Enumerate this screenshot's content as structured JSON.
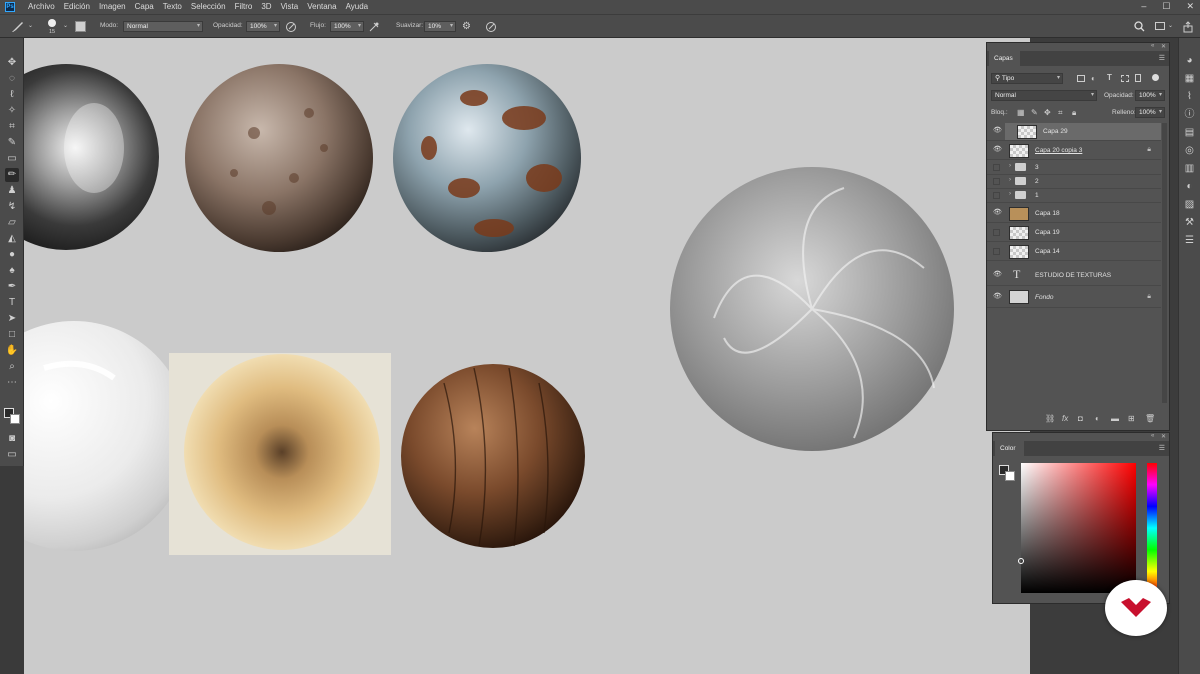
{
  "menubar": {
    "app_icon": "Ps",
    "items": [
      "Archivo",
      "Edición",
      "Imagen",
      "Capa",
      "Texto",
      "Selección",
      "Filtro",
      "3D",
      "Vista",
      "Ventana",
      "Ayuda"
    ],
    "window_buttons": [
      "–",
      "☐",
      "✕"
    ]
  },
  "options": {
    "brush_size": "15",
    "mode_label": "Modo:",
    "mode_value": "Normal",
    "opacity_label": "Opacidad:",
    "opacity_value": "100%",
    "flow_label": "Flujo:",
    "flow_value": "100%",
    "smooth_label": "Suavizar:",
    "smooth_value": "10%"
  },
  "layers_panel": {
    "tab": "Capas",
    "filter_value": "Tipo",
    "blend_mode": "Normal",
    "opacity_label": "Opacidad:",
    "opacity_value": "100%",
    "lock_label": "Bloq.:",
    "fill_label": "Relleno:",
    "fill_value": "100%",
    "layers": [
      {
        "name": "Capa 29",
        "visible": true,
        "kind": "pixel",
        "selected": true
      },
      {
        "name": "Capa 20 copia 3",
        "visible": true,
        "kind": "pixel",
        "locked": true
      },
      {
        "name": "3",
        "visible": false,
        "kind": "group"
      },
      {
        "name": "2",
        "visible": false,
        "kind": "group"
      },
      {
        "name": "1",
        "visible": false,
        "kind": "group"
      },
      {
        "name": "Capa 18",
        "visible": true,
        "kind": "pixel"
      },
      {
        "name": "Capa 19",
        "visible": false,
        "kind": "pixel"
      },
      {
        "name": "Capa 14",
        "visible": false,
        "kind": "pixel"
      },
      {
        "name": "ESTUDIO DE TEXTURAS",
        "visible": true,
        "kind": "text"
      },
      {
        "name": "Fondo",
        "visible": true,
        "kind": "background",
        "locked": true
      }
    ],
    "footer_icons": [
      "link-icon",
      "fx-icon",
      "mask-icon",
      "adjustment-icon",
      "folder-icon",
      "new-layer-icon",
      "trash-icon"
    ]
  },
  "color_panel": {
    "tab": "Color",
    "hue_color": "#ff0000"
  },
  "colors": {
    "canvas_bg": "#cbcbcb",
    "panel_bg": "#535353",
    "chrome_bg": "#4b4b4b",
    "accent": "#31a8ff",
    "badge": "#c8102e"
  }
}
